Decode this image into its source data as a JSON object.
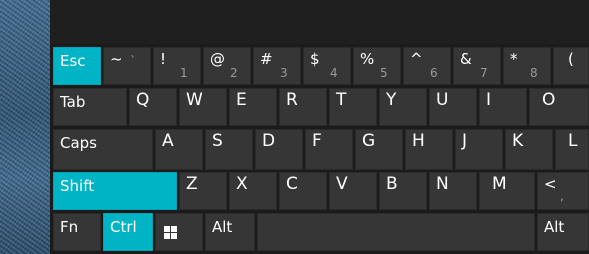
{
  "keyboard": {
    "row_numbers": [
      {
        "id": "esc",
        "label": "Esc",
        "accent": true
      },
      {
        "id": "tilde",
        "shift": "~",
        "base": "`"
      },
      {
        "id": "1",
        "shift": "!",
        "base": "1"
      },
      {
        "id": "2",
        "shift": "@",
        "base": "2"
      },
      {
        "id": "3",
        "shift": "#",
        "base": "3"
      },
      {
        "id": "4",
        "shift": "$",
        "base": "4"
      },
      {
        "id": "5",
        "shift": "%",
        "base": "5"
      },
      {
        "id": "6",
        "shift": "^",
        "base": "6"
      },
      {
        "id": "7",
        "shift": "&",
        "base": "7"
      },
      {
        "id": "8",
        "shift": "*",
        "base": "8"
      },
      {
        "id": "9",
        "shift": "(",
        "base": ""
      }
    ],
    "row_qwerty": [
      {
        "id": "tab",
        "label": "Tab"
      },
      {
        "id": "q",
        "label": "Q"
      },
      {
        "id": "w",
        "label": "W"
      },
      {
        "id": "e",
        "label": "E"
      },
      {
        "id": "r",
        "label": "R"
      },
      {
        "id": "t",
        "label": "T"
      },
      {
        "id": "y",
        "label": "Y"
      },
      {
        "id": "u",
        "label": "U"
      },
      {
        "id": "i",
        "label": "I"
      },
      {
        "id": "o",
        "label": "O"
      }
    ],
    "row_home": [
      {
        "id": "caps",
        "label": "Caps"
      },
      {
        "id": "a",
        "label": "A"
      },
      {
        "id": "s",
        "label": "S"
      },
      {
        "id": "d",
        "label": "D"
      },
      {
        "id": "f",
        "label": "F"
      },
      {
        "id": "g",
        "label": "G"
      },
      {
        "id": "h",
        "label": "H"
      },
      {
        "id": "j",
        "label": "J"
      },
      {
        "id": "k",
        "label": "K"
      },
      {
        "id": "l",
        "label": "L"
      }
    ],
    "row_shift": [
      {
        "id": "shift",
        "label": "Shift",
        "accent": true
      },
      {
        "id": "z",
        "label": "Z"
      },
      {
        "id": "x",
        "label": "X"
      },
      {
        "id": "c",
        "label": "C"
      },
      {
        "id": "v",
        "label": "V"
      },
      {
        "id": "b",
        "label": "B"
      },
      {
        "id": "n",
        "label": "N"
      },
      {
        "id": "m",
        "label": "M"
      },
      {
        "id": "comma",
        "shift": "<",
        "base": ","
      }
    ],
    "row_bottom": [
      {
        "id": "fn",
        "label": "Fn"
      },
      {
        "id": "ctrl",
        "label": "Ctrl",
        "accent": true
      },
      {
        "id": "win",
        "icon": "windows-icon"
      },
      {
        "id": "alt-left",
        "label": "Alt"
      },
      {
        "id": "space",
        "label": ""
      },
      {
        "id": "alt-right",
        "label": "Alt"
      }
    ]
  },
  "colors": {
    "accent": "#00b4c5",
    "key": "#363636",
    "panel": "#1b1b1b"
  }
}
